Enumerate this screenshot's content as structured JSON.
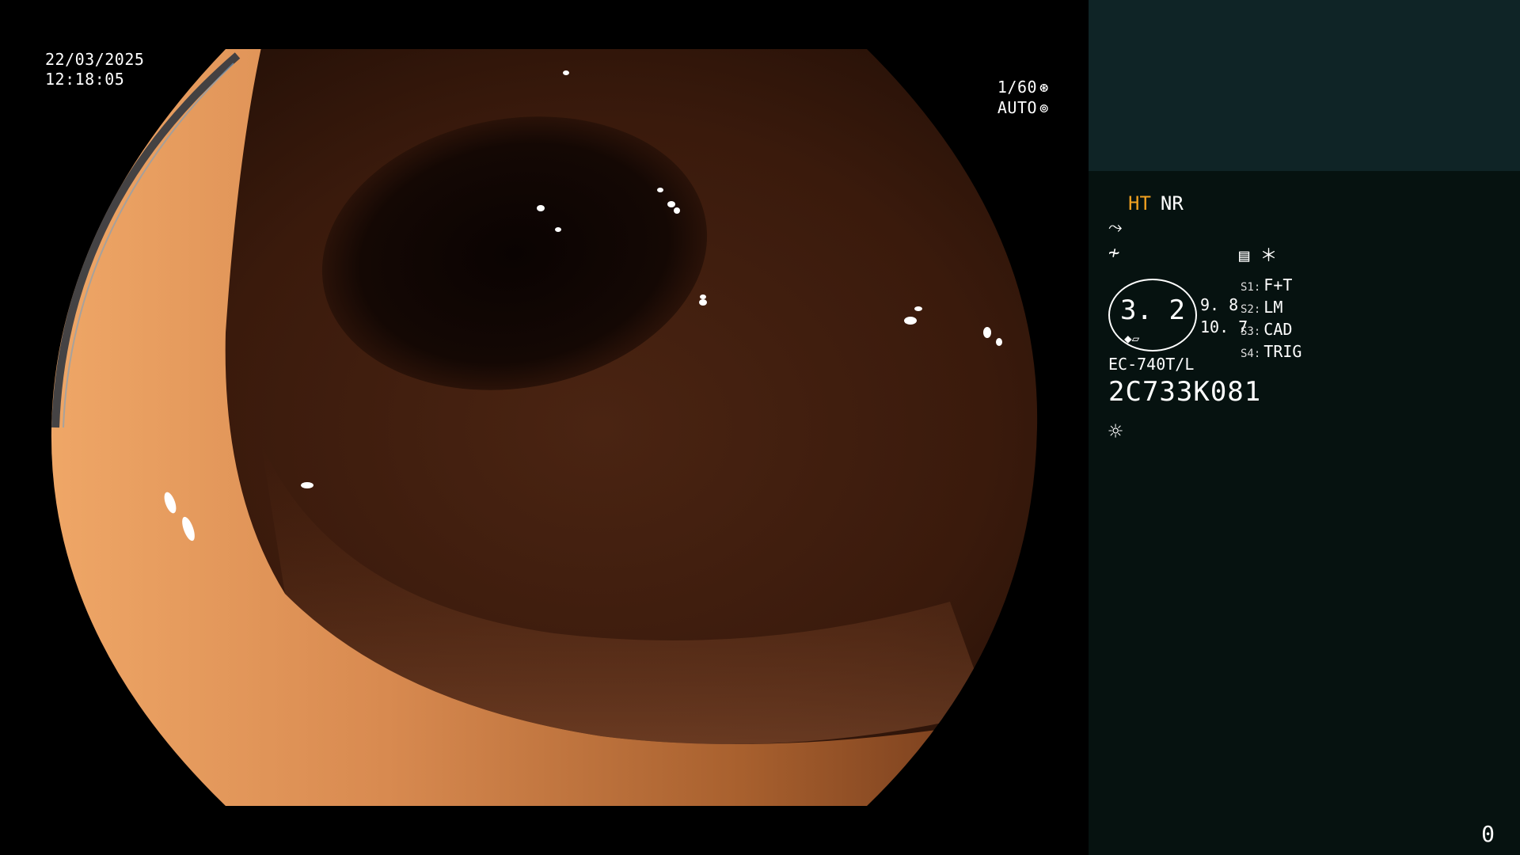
{
  "overlay": {
    "date": "22/03/2025",
    "time": "12:18:05",
    "shutter_speed": "1/60",
    "exposure_mode": "AUTO",
    "shutter_icon": "aperture-icon",
    "auto_icon": "iris-icon"
  },
  "side_panel": {
    "mode_ht": "HT",
    "mode_nr": "NR",
    "enhancement_icon": "tone-curve-icon",
    "structure_icon": "structure-icon",
    "menu_icon": "menu-icon",
    "star_mark": "＊",
    "zoom_value": "3. 2",
    "right_values": [
      "9. 8",
      "10. 7"
    ],
    "switches": [
      {
        "key": "S1:",
        "value": "F+T"
      },
      {
        "key": "S2:",
        "value": "LM"
      },
      {
        "key": "S3:",
        "value": "CAD"
      },
      {
        "key": "S4:",
        "value": "TRIG"
      }
    ],
    "scope_model": "EC-740T/L",
    "serial": "2C733K081",
    "light_icon": "light-source-icon",
    "counter": "0"
  },
  "colors": {
    "panel_bg": "#061210",
    "panel_top_bg": "#0f2426",
    "ht_accent": "#f0a020",
    "tissue_light": "#e89a60",
    "tissue_dark": "#3a1a0c"
  }
}
